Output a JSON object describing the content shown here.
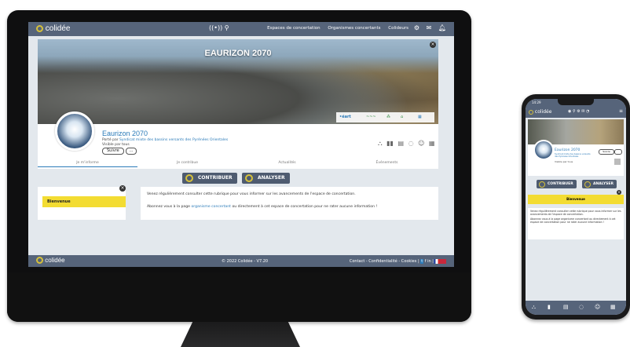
{
  "colors": {
    "nav": "#56647a",
    "accent": "#d6c13a",
    "link": "#2a7ab8",
    "highlight": "#f3dc32"
  },
  "nav": {
    "brand": "colidée",
    "links": [
      "Espaces de concertation",
      "Organismes concertants",
      "Colideurs"
    ]
  },
  "banner": {
    "title": "EAURIZON 2070"
  },
  "project": {
    "title": "Eaurizon 2070",
    "porte_par_prefix": "Porté par",
    "porte_par_org": "Syndicat mixte des bassins versants des Pyrénées Orientales",
    "visibility": "Visible par tous",
    "follow_label": "Suivre",
    "more_label": "..."
  },
  "tabs": [
    "Je m'informe",
    "Je contribue",
    "Actualités",
    "Événements"
  ],
  "actions": {
    "contribute": "CONTRIBUER",
    "analyse": "ANALYSER"
  },
  "sidebar": {
    "welcome": "Bienvenue"
  },
  "content": {
    "p1": "Venez régulièrement consulter cette rubrique pour vous informer sur les avancements de l'espace de concertation.",
    "p2_prefix": "Abonnez vous à la page",
    "p2_link": "organisme concertant",
    "p2_suffix": "ou directement à cet espace de concertation pour ne rater aucune information !"
  },
  "footer": {
    "brand": "colidée",
    "copyright": "© 2022 Colidée - V7.20",
    "links": "Contact - Confidentialité - Cookies |"
  },
  "phone": {
    "time": "14:29",
    "title": "Eaurizon 2070",
    "follow_label": "Suivre",
    "contribute": "CONTRIBUER",
    "analyse": "ANALYSER",
    "welcome": "Bienvenue",
    "p1": "Venez régulièrement consulter cette rubrique pour vous informer sur les avancements de l'espace de concertation.",
    "p2": "Abonnez vous à la page organisme concertant ou directement à cet espace de concertation pour ne rater aucune information !"
  }
}
